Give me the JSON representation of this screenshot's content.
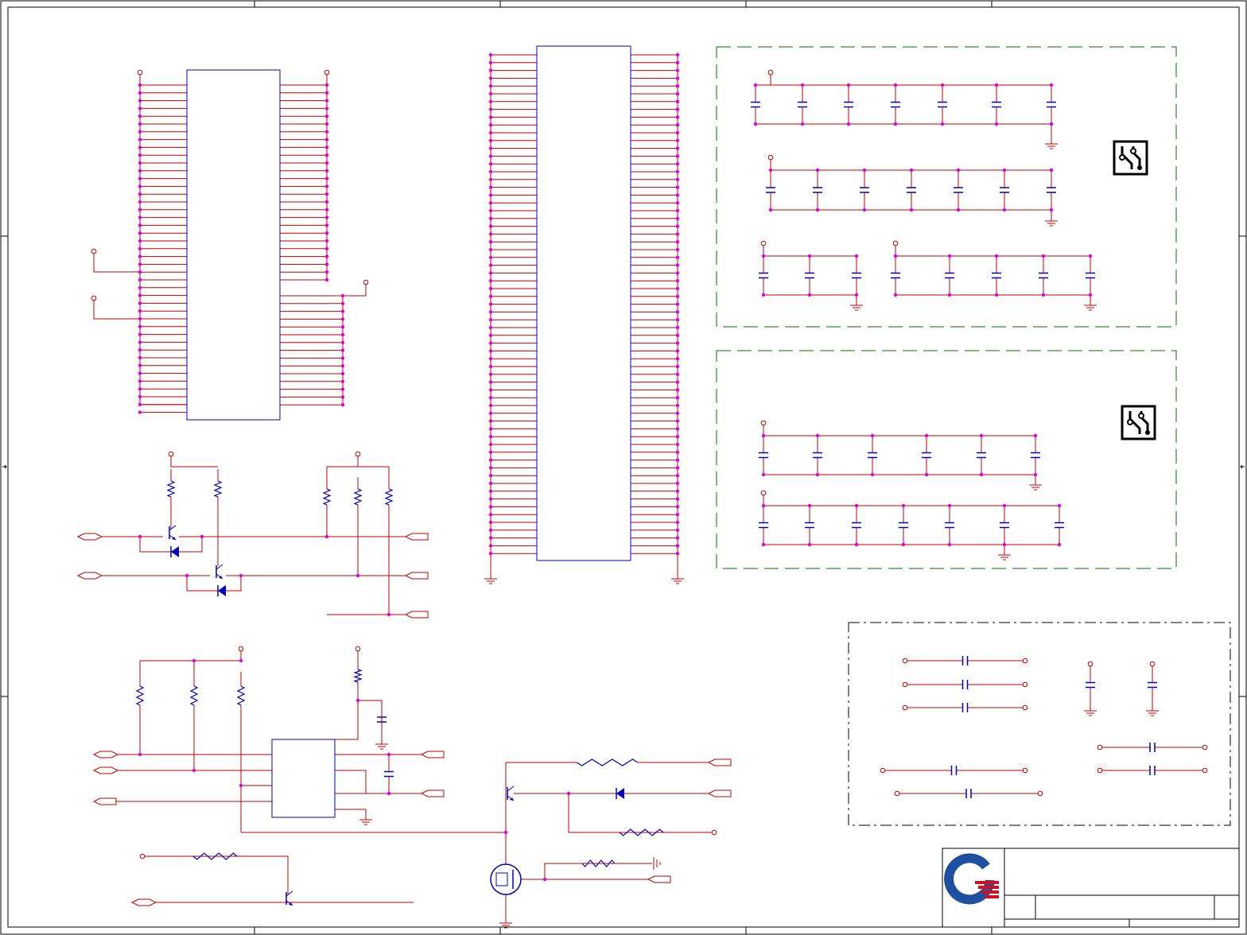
{
  "sheet": {
    "kind": "schematic",
    "colors": {
      "frame": "#000000",
      "wire": "#c00000",
      "component": "#0000c0",
      "junction": "#e000e0",
      "supply_port": "#c00000",
      "dashed_group": "#007000",
      "logo_blue": "#1f4fa0",
      "logo_red": "#d01020"
    },
    "icons": [
      "pcb-trace-icon",
      "pcb-trace-icon",
      "quanta-logo-icon"
    ]
  },
  "title_block": {
    "logo_name": "quanta-logo-icon",
    "title": "",
    "sheet": "",
    "rev": ""
  },
  "text": {
    "ic1_label": "",
    "ic2_label": "",
    "ic3_label": ""
  }
}
